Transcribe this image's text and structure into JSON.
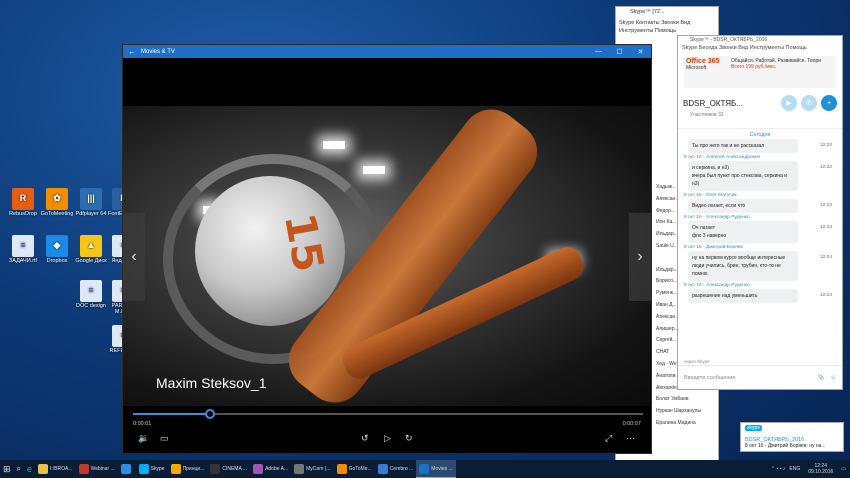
{
  "desktop": {
    "icons": [
      {
        "label": "RebusDrop",
        "color": "#e85d14",
        "glyph": "R"
      },
      {
        "label": "GoToMeeting",
        "color": "#f28c00",
        "glyph": "✿"
      },
      {
        "label": "Pdfplayer 64",
        "color": "#2d6db3",
        "glyph": "|||"
      },
      {
        "label": "FontE... 201",
        "color": "#2a5fa0",
        "glyph": "F"
      },
      {
        "label": "ЗАДАЧИ.rtf",
        "color": "#dfe8f5",
        "glyph": "≡"
      },
      {
        "label": "Dropbox",
        "color": "#1a8be6",
        "glyph": "◆"
      },
      {
        "label": "Google Диск",
        "color": "#f5c518",
        "glyph": "▲"
      },
      {
        "label": "Яндекс...",
        "color": "#dfe8f5",
        "glyph": "≡"
      },
      {
        "label": "DOC design",
        "color": "#dfe8f5",
        "glyph": "≡"
      },
      {
        "label": "PARFU... M.IN...",
        "color": "#dfe8f5",
        "glyph": "≡"
      },
      {
        "label": "REFERE...",
        "color": "#dfe8f5",
        "glyph": "≡"
      }
    ]
  },
  "movies": {
    "app_title": "Movies & TV",
    "video_title": "Maxim Steksov_1",
    "ball_number": "15",
    "time_current": "0:00:01",
    "time_total": "0:00:07",
    "progress_fraction": 0.15
  },
  "skype_back": {
    "title": "Skype™ [72...",
    "menu1": "Skype  Контакты  Звонки  Вид",
    "menu2": "Инструменты  Помощь",
    "contacts": [
      "Хадыж...",
      "Алексан...",
      "Федор...",
      "Ион Ка...",
      "Ильдар...",
      "Saule U...",
      "",
      "Ильдар...",
      "Борисо...",
      "Руменк...",
      "Иван Д...",
      "Алексан...",
      "Алишер...",
      "Сергей...",
      "CHAT",
      "Ход - We...",
      "Анатоли...",
      "Alexander Kitchenko",
      "Болат Умбаев",
      "Нуркан Шарханулы",
      "Ералина Мадина"
    ]
  },
  "skype": {
    "title": "Skype™ - BDSR_ОКТЯБРЬ_2016",
    "menu": "Skype  Беседа  Звонки  Вид  Инструменты  Помощь",
    "ad_brand": "Office 365",
    "ad_sub": "Microsoft",
    "ad_text": "Общайся. Работай. Развивайся. Твори",
    "ad_price": "Всего 199 руб./мес.",
    "chat_name": "BDSR_ОКТЯБ...",
    "participants": "Участников 33",
    "today": "Сегодня",
    "messages": [
      {
        "sender": "",
        "lines": [
          "Ты про него так и не рассказал"
        ],
        "time": "12:22"
      },
      {
        "sender": "8 окт 16 - Алексей Александрович",
        "lines": [
          "и серкина, и н3)",
          "вчера был пункт про стексова, серкина и н3)"
        ],
        "time": "12:22"
      },
      {
        "sender": "8 окт 16 - Олег Матусик",
        "lines": [
          "Видео лагает, если что"
        ],
        "time": "12:23"
      },
      {
        "sender": "8 окт 16 - Александр Руденко",
        "lines": [
          "Оч лагает",
          "фпс 3 наверно"
        ],
        "time": "12:23"
      },
      {
        "sender": "8 окт 16 - Дмитрий Боряев",
        "lines": [
          "ну на первом курсе вообще интересные люди учились, брин, трубин, кто-то не помню."
        ],
        "time": "12:24"
      },
      {
        "sender": "8 окт 16 - Александр Руденко",
        "lines": [
          "разрешение над уменьшить"
        ],
        "time": "12:24"
      }
    ],
    "via": "через Skype",
    "compose_placeholder": "Введите сообщение"
  },
  "notification": {
    "app": "skype",
    "title": "BDSR_ОКТЯБРЬ_2016",
    "text": "8 окт 16 - Дмитрий Боряев: ну на..."
  },
  "taskbar": {
    "items": [
      {
        "label": "I:\\BROA...",
        "color": "#e8c14a"
      },
      {
        "label": "Webinar ...",
        "color": "#c0392b"
      },
      {
        "label": "",
        "color": "#2d8ee6"
      },
      {
        "label": "Skype",
        "color": "#00aff0"
      },
      {
        "label": "Принци...",
        "color": "#f2a900"
      },
      {
        "label": "CINEMA ...",
        "color": "#333333"
      },
      {
        "label": "Adobe A...",
        "color": "#9b59b6"
      },
      {
        "label": "MyCam (...",
        "color": "#777777"
      },
      {
        "label": "GoToMe...",
        "color": "#f28c00"
      },
      {
        "label": "Cerebro ...",
        "color": "#3a7bd5"
      },
      {
        "label": "Movies ...",
        "color": "#1e6fc9"
      }
    ],
    "lang": "ENG",
    "time": "12:24",
    "date": "09.10.2016"
  }
}
